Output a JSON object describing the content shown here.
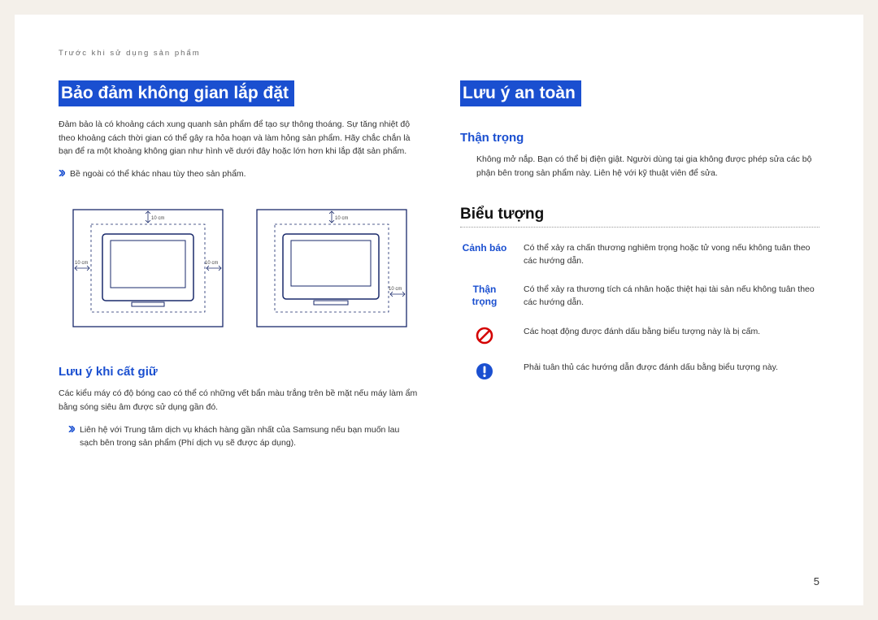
{
  "breadcrumb": "Trước khi sử dụng sản phẩm",
  "page_number": "5",
  "left": {
    "title": "Bảo đảm không gian lắp đặt",
    "intro": "Đảm bảo là có khoảng cách xung quanh sản phẩm để tạo sự thông thoáng. Sự tăng nhiệt độ theo khoảng cách thời gian có thể gây ra hỏa hoạn và làm hỏng sản phẩm. Hãy chắc chắn là bạn để ra một khoảng không gian như hình vẽ dưới đây hoặc lớn hơn khi lắp đặt sản phẩm.",
    "note1": "Bề ngoài có thể khác nhau tùy theo sản phẩm.",
    "diagram_labels": {
      "d10": "10 cm"
    },
    "storage_title": "Lưu ý khi cất giữ",
    "storage_text": "Các kiểu máy có độ bóng cao có thể có những vết bẩn màu trắng trên bề mặt nếu máy làm ẩm bằng sóng siêu âm được sử dụng gần đó.",
    "storage_note": "Liên hệ với Trung tâm dịch vụ khách hàng gần nhất của Samsung nếu bạn muốn lau sạch bên trong sản phẩm (Phí dịch vụ sẽ được áp dụng)."
  },
  "right": {
    "title": "Lưu ý an toàn",
    "caution_heading": "Thận trọng",
    "caution_body": "Không mở nắp. Bạn có thể bị điện giật. Người dùng tại gia không được phép sửa các bộ phận bên trong sản phẩm này. Liên hệ với kỹ thuật viên để sửa.",
    "symbols_heading": "Biểu tượng",
    "symbols": [
      {
        "key": "Cảnh báo",
        "key_type": "text",
        "text": "Có thể xảy ra chấn thương nghiêm trọng hoặc tử vong nếu không tuân theo các hướng dẫn."
      },
      {
        "key": "Thận trọng",
        "key_type": "text",
        "text": "Có thể xảy ra thương tích cá nhân hoặc thiệt hại tài sản nếu không tuân theo các hướng dẫn."
      },
      {
        "key": "prohibit",
        "key_type": "icon",
        "text": "Các hoạt động được đánh dấu bằng biểu tượng này là bị cấm."
      },
      {
        "key": "mandatory",
        "key_type": "icon",
        "text": "Phải tuân thủ các hướng dẫn được đánh dấu bằng biểu tượng này."
      }
    ]
  }
}
